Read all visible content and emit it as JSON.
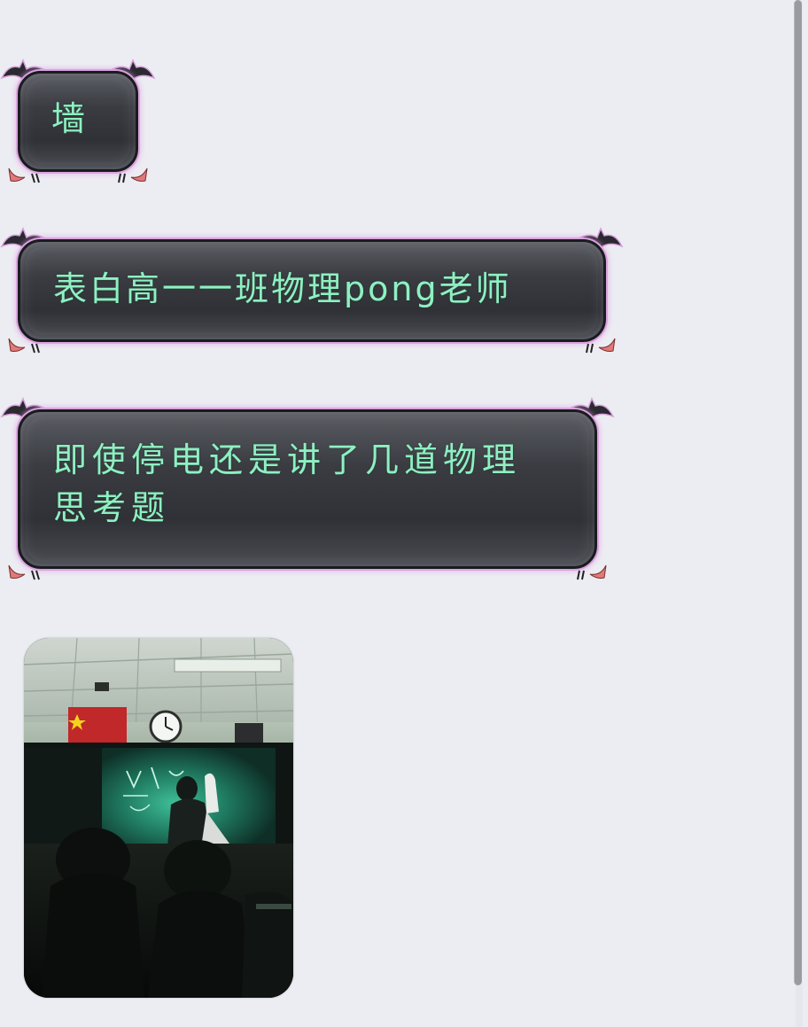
{
  "messages": [
    {
      "text": "墙"
    },
    {
      "text": "表白高一一班物理pong老师"
    },
    {
      "text": "即使停电还是讲了几道物理\n思考题"
    }
  ],
  "photo": {
    "icon": "classroom-photo",
    "scene": "dark-classroom-blackboard"
  },
  "colors": {
    "background": "#ecedf2",
    "bubble_text": "#8ef0c2",
    "bubble_glow": "#d8a4dc",
    "bubble_body": "#35373c"
  }
}
